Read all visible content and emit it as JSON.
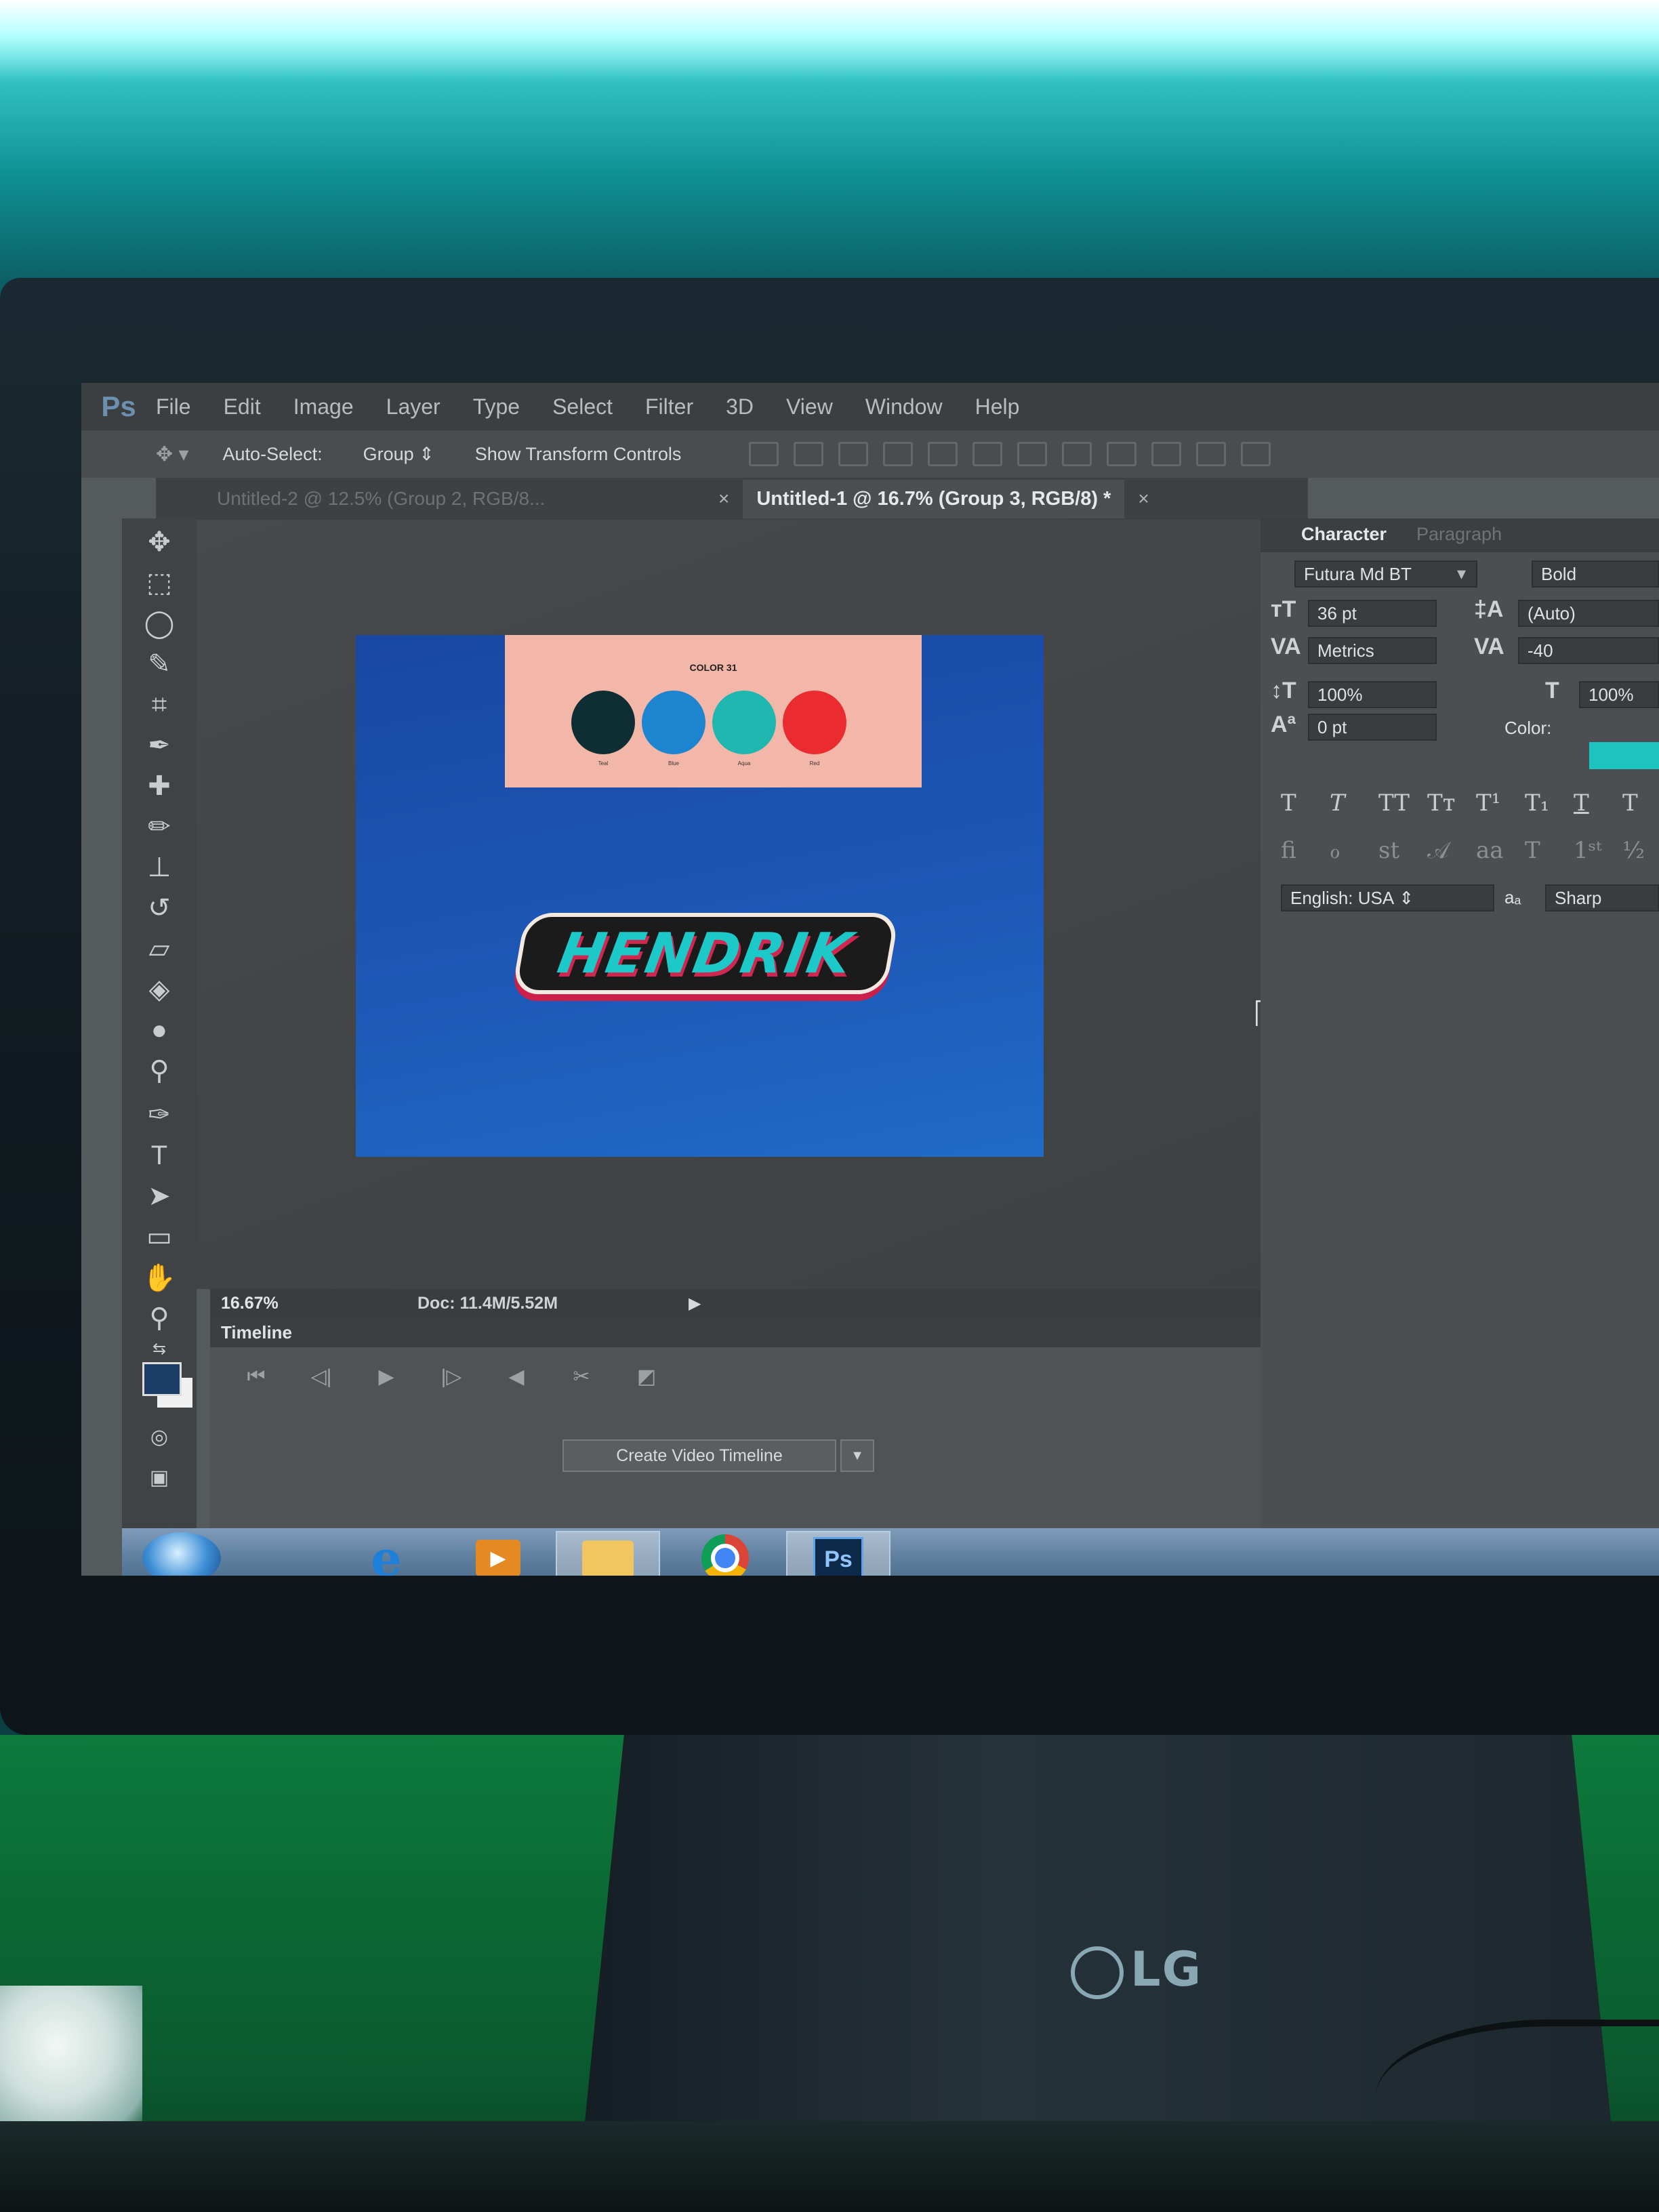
{
  "menu": {
    "items": [
      "File",
      "Edit",
      "Image",
      "Layer",
      "Type",
      "Select",
      "Filter",
      "3D",
      "View",
      "Window",
      "Help"
    ]
  },
  "options_bar": {
    "auto_select_label": "Auto-Select:",
    "auto_select_value": "Group",
    "show_transform_label": "Show Transform Controls"
  },
  "tabs": {
    "inactive_label": "Untitled-2 @ 12.5% (Group 2, RGB/8...",
    "active_label": "Untitled-1 @ 16.7% (Group 3, RGB/8) *"
  },
  "canvas": {
    "palette_title": "COLOR 31",
    "dots": [
      {
        "color": "#0f2e33",
        "label": "Teal"
      },
      {
        "color": "#1d85cf",
        "label": "Blue"
      },
      {
        "color": "#1fb7b0",
        "label": "Aqua"
      },
      {
        "color": "#ea2b2f",
        "label": "Red"
      }
    ],
    "headline": "HENDRIK"
  },
  "status": {
    "zoom": "16.67%",
    "doc": "Doc: 11.4M/5.52M"
  },
  "timeline": {
    "title": "Timeline",
    "create_button": "Create Video Timeline"
  },
  "character_panel": {
    "tab_active": "Character",
    "tab_inactive": "Paragraph",
    "font_family": "Futura Md BT",
    "font_style": "Bold",
    "font_size": "36 pt",
    "leading": "(Auto)",
    "kerning": "Metrics",
    "tracking": "-40",
    "vertical_scale": "100%",
    "horizontal_scale": "100%",
    "baseline_shift": "0 pt",
    "color_label": "Color:",
    "color_value": "#1dc4bf",
    "language": "English: USA",
    "aa_label": "a",
    "antialias": "Sharp"
  },
  "monitor": {
    "brand": "LG"
  },
  "taskbar": {
    "ps_label": "Ps"
  }
}
